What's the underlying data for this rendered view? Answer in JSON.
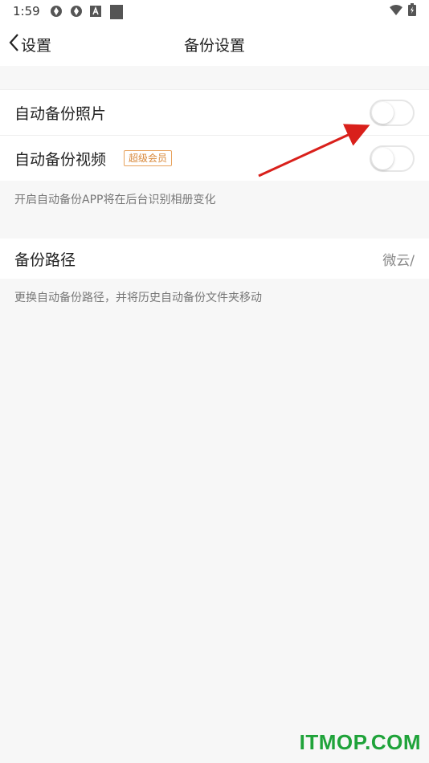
{
  "status_bar": {
    "time": "1:59",
    "icons": [
      "sync-icon",
      "sync-icon",
      "app-icon",
      "square-icon"
    ],
    "right_icons": [
      "wifi-icon",
      "battery-icon"
    ]
  },
  "nav": {
    "back_label": "设置",
    "title": "备份设置"
  },
  "settings": {
    "auto_photo_label": "自动备份照片",
    "auto_photo_enabled": false,
    "auto_video_label": "自动备份视频",
    "auto_video_badge": "超级会员",
    "auto_video_enabled": false,
    "note": "开启自动备份APP将在后台识别相册变化",
    "path_label": "备份路径",
    "path_value": "微云/",
    "path_note": "更换自动备份路径，并将历史自动备份文件夹移动"
  },
  "annotation": {
    "arrow_color": "#d9201b"
  },
  "watermark": "ITMOP.COM",
  "colors": {
    "accent_badge": "#d8883a",
    "watermark": "#1fa33a"
  }
}
